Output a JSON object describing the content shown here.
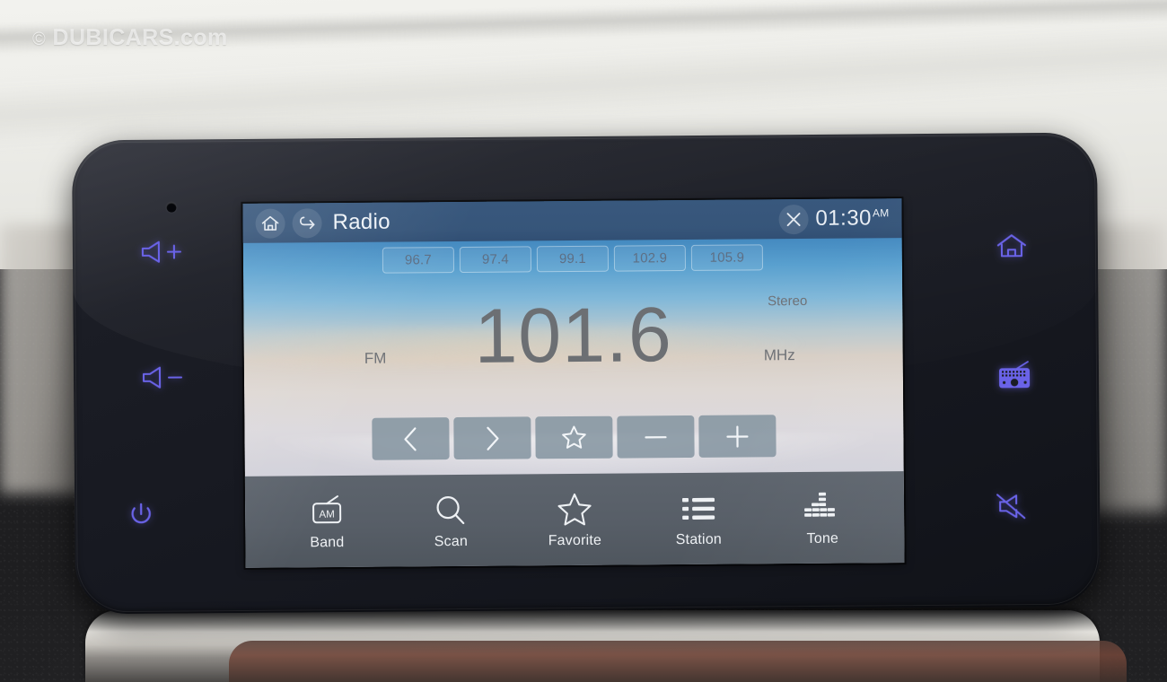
{
  "watermark": {
    "copyright_symbol": "©",
    "text": "DUBICARS.com"
  },
  "head_unit": {
    "bezel_keys": {
      "volume_up": "volume-up",
      "volume_down": "volume-down",
      "power": "power",
      "home": "home",
      "radio": "radio",
      "mute": "mute"
    },
    "accent_color": "#6a63e8"
  },
  "screen": {
    "header": {
      "home_icon": "home-icon",
      "back_icon": "back-icon",
      "title": "Radio",
      "close_icon": "close-icon",
      "time": "01:30",
      "ampm": "AM",
      "bar_color": "#39567a"
    },
    "presets": [
      {
        "label": "96.7"
      },
      {
        "label": "97.4"
      },
      {
        "label": "99.1"
      },
      {
        "label": "102.9"
      },
      {
        "label": "105.9"
      }
    ],
    "now_playing": {
      "band": "FM",
      "frequency": "101.6",
      "unit": "MHz",
      "stereo": "Stereo"
    },
    "controls": [
      {
        "name": "prev-station-button",
        "icon": "chevron-left-icon"
      },
      {
        "name": "next-station-button",
        "icon": "chevron-right-icon"
      },
      {
        "name": "add-favorite-button",
        "icon": "star-icon"
      },
      {
        "name": "tune-down-button",
        "icon": "minus-icon"
      },
      {
        "name": "tune-up-button",
        "icon": "plus-icon"
      }
    ],
    "bottom_nav": [
      {
        "label": "Band",
        "icon": "radio-am-icon",
        "badge": "AM"
      },
      {
        "label": "Scan",
        "icon": "search-icon"
      },
      {
        "label": "Favorite",
        "icon": "star-icon"
      },
      {
        "label": "Station",
        "icon": "list-icon"
      },
      {
        "label": "Tone",
        "icon": "equalizer-icon"
      }
    ],
    "nav_bar_color": "#575e67"
  }
}
